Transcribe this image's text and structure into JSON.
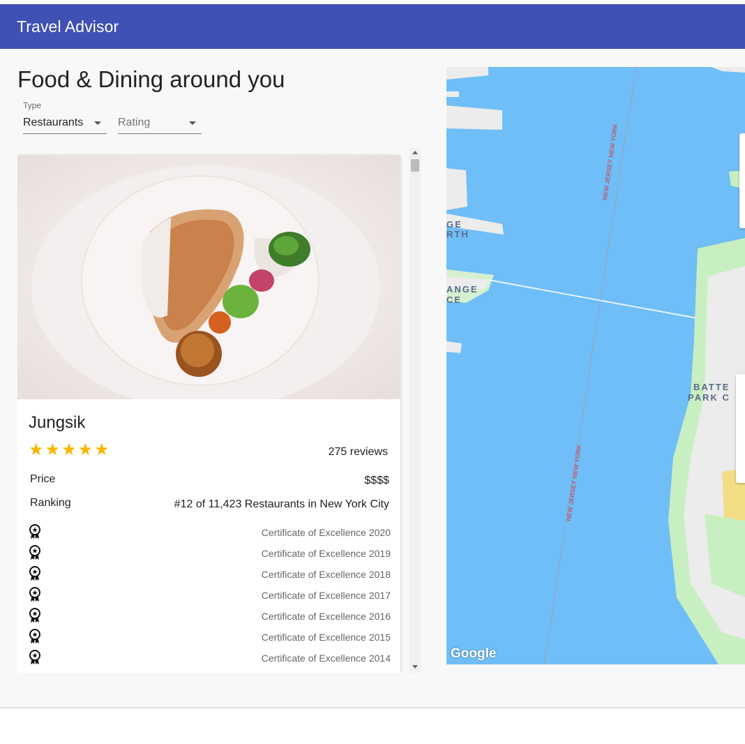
{
  "app": {
    "title": "Travel Advisor"
  },
  "main": {
    "heading": "Food & Dining around you",
    "type_field": {
      "label": "Type",
      "value": "Restaurants"
    },
    "rating_field": {
      "placeholder": "Rating"
    }
  },
  "place": {
    "name": "Jungsik",
    "rating": 5,
    "reviews": "275 reviews",
    "price_label": "Price",
    "price_value": "$$$$",
    "ranking_label": "Ranking",
    "ranking_value": "#12 of 11,423 Restaurants in New York City",
    "awards": [
      "Certificate of Excellence 2020",
      "Certificate of Excellence 2019",
      "Certificate of Excellence 2018",
      "Certificate of Excellence 2017",
      "Certificate of Excellence 2016",
      "Certificate of Excellence 2015",
      "Certificate of Excellence 2014"
    ],
    "award_icon": "award-icon",
    "star_icon": "star-icon"
  },
  "map": {
    "labels": {
      "nj_ny_top": "NEW JERSEY NEW YORK",
      "nj_ny_bottom": "NEW JERSEY NEW YORK",
      "partial_ge": "GE",
      "partial_rth": "RTH",
      "partial_ange": "ANGE",
      "partial_ce": "CE",
      "battery": "BATTE",
      "park": "PARK C"
    },
    "attribution": "Google"
  },
  "colors": {
    "appbar": "#3f51b5",
    "star": "#fbb400",
    "water": "#6fbef7",
    "land": "#ececec",
    "park": "#c8efc1"
  }
}
